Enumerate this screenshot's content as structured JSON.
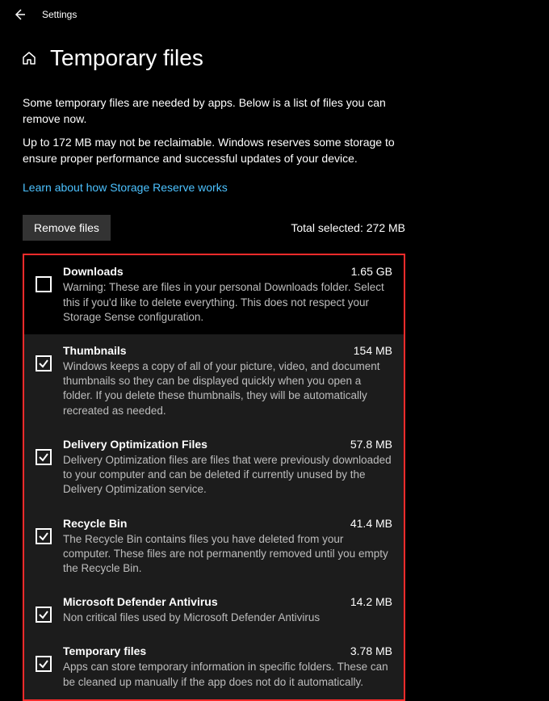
{
  "app_title": "Settings",
  "page_title": "Temporary files",
  "intro_1": "Some temporary files are needed by apps. Below is a list of files you can remove now.",
  "intro_2": "Up to 172 MB may not be reclaimable. Windows reserves some storage to ensure proper performance and successful updates of your device.",
  "link_text": "Learn about how Storage Reserve works",
  "remove_button": "Remove files",
  "total_selected_label": "Total selected: 272 MB",
  "items": [
    {
      "checked": false,
      "title": "Downloads",
      "size": "1.65 GB",
      "desc": "Warning: These are files in your personal Downloads folder. Select this if you'd like to delete everything. This does not respect your Storage Sense configuration."
    },
    {
      "checked": true,
      "title": "Thumbnails",
      "size": "154 MB",
      "desc": "Windows keeps a copy of all of your picture, video, and document thumbnails so they can be displayed quickly when you open a folder. If you delete these thumbnails, they will be automatically recreated as needed."
    },
    {
      "checked": true,
      "title": "Delivery Optimization Files",
      "size": "57.8 MB",
      "desc": "Delivery Optimization files are files that were previously downloaded to your computer and can be deleted if currently unused by the Delivery Optimization service."
    },
    {
      "checked": true,
      "title": "Recycle Bin",
      "size": "41.4 MB",
      "desc": "The Recycle Bin contains files you have deleted from your computer. These files are not permanently removed until you empty the Recycle Bin."
    },
    {
      "checked": true,
      "title": "Microsoft Defender Antivirus",
      "size": "14.2 MB",
      "desc": "Non critical files used by Microsoft Defender Antivirus"
    },
    {
      "checked": true,
      "title": "Temporary files",
      "size": "3.78 MB",
      "desc": "Apps can store temporary information in specific folders. These can be cleaned up manually if the app does not do it automatically."
    }
  ]
}
